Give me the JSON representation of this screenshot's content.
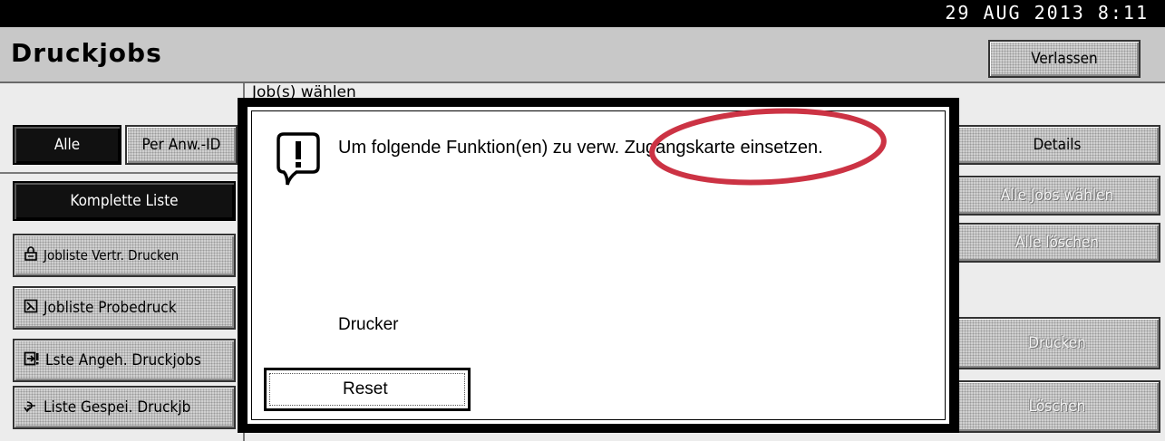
{
  "status_bar": {
    "datetime": "29 AUG  2013  8:11"
  },
  "header": {
    "title": "Druckjobs",
    "exit_label": "Verlassen"
  },
  "main": {
    "subtitle": "Job(s) wählen"
  },
  "left_panel": {
    "filter_all": "Alle",
    "filter_user": "Per Anw.-ID",
    "full_list": "Komplette Liste",
    "list_items": [
      {
        "icon": "lock-icon",
        "label": "Jobliste Vertr. Drucken"
      },
      {
        "icon": "sample-print-icon",
        "label": "Jobliste Probedruck"
      },
      {
        "icon": "hold-print-icon",
        "label": "Lste Angeh. Druckjobs"
      },
      {
        "icon": "stored-print-icon",
        "label": "Liste Gespei. Druckjb"
      }
    ]
  },
  "right_panel": {
    "details": "Details",
    "select_all": "Alle Jobs wählen",
    "delete_all": "Alle löschen",
    "print": "Drucken",
    "delete": "Löschen"
  },
  "dialog": {
    "message": "Um folgende Funktion(en) zu verw. Zugangskarte einsetzen.",
    "function": "Drucker",
    "reset_label": "Reset"
  },
  "colors": {
    "annotation": "#cc3344",
    "background": "#ececec",
    "header": "#c8c8c8"
  }
}
